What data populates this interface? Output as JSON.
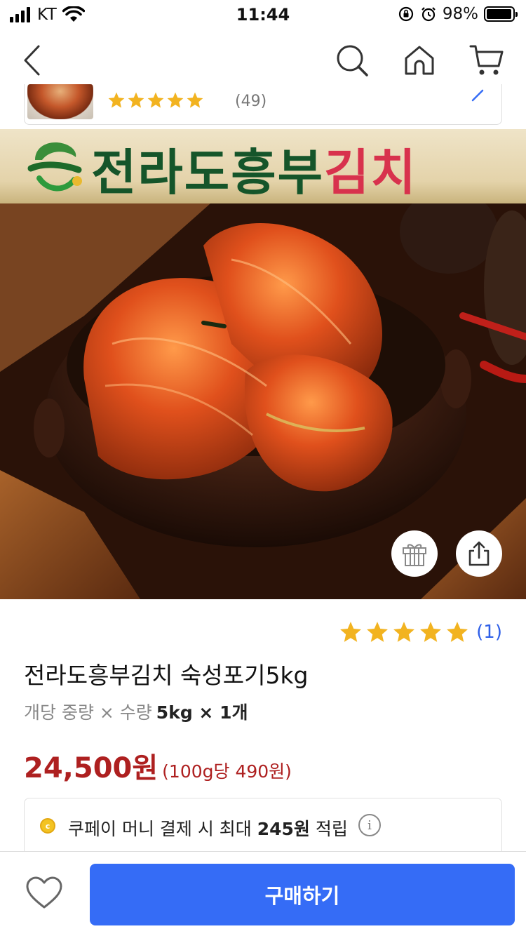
{
  "status_bar": {
    "carrier": "KT",
    "time": "11:44",
    "battery": "98%",
    "battery_level": 0.98
  },
  "nav": {
    "back_icon": "chevron-left-icon",
    "search_icon": "search-icon",
    "home_icon": "home-icon",
    "cart_icon": "cart-icon"
  },
  "mini_card": {
    "rating_count": "(49)",
    "stars": 5
  },
  "hero": {
    "brand_main": "전라도흥부",
    "brand_accent": "김치",
    "gift_icon": "gift-icon",
    "share_icon": "share-icon"
  },
  "product": {
    "rating_count": "(1)",
    "stars": 5,
    "title": "전라도흥부김치 숙성포기5kg",
    "unit_label": "개당 중량 × 수량",
    "unit_value": "5kg × 1개",
    "price": "24,500원",
    "unit_price": "(100g당 490원)"
  },
  "pay": {
    "text_before": "쿠페이 머니 결제 시 최대 ",
    "amount": "245원",
    "text_after": " 적립",
    "info_icon": "i"
  },
  "bottom": {
    "buy_label": "구매하기",
    "wish_icon": "heart-icon"
  },
  "colors": {
    "accent_blue": "#356cf6",
    "price_red": "#ae2020",
    "star_gold": "#f2b320"
  }
}
